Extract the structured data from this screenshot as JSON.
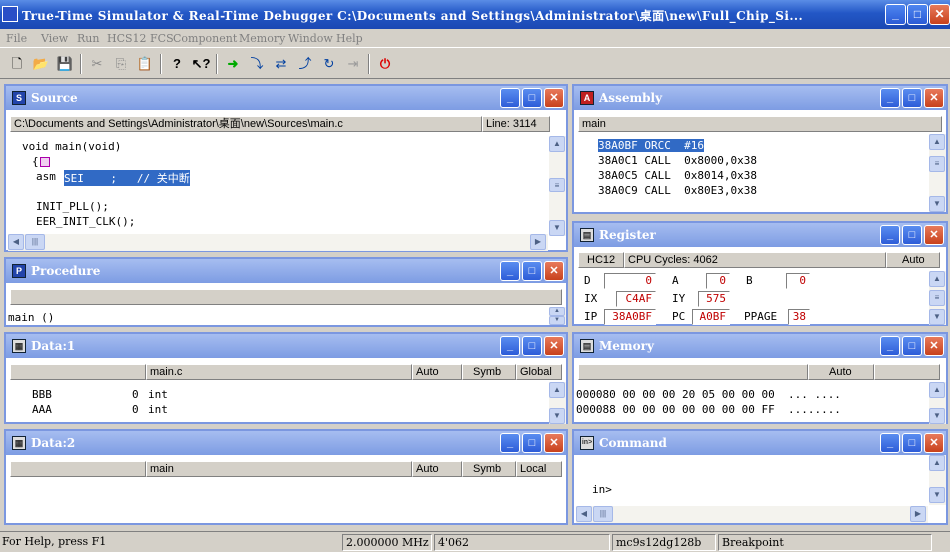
{
  "title": "True-Time Simulator & Real-Time Debugger   C:\\Documents and Settings\\Administrator\\桌面\\new\\Full_Chip_Si...",
  "menu": [
    "File",
    "View",
    "Run",
    "HCS12 FCS",
    "Component",
    "Memory",
    "Window",
    "Help"
  ],
  "source": {
    "title": "Source",
    "path": "C:\\Documents and Settings\\Administrator\\桌面\\new\\Sources\\main.c",
    "line_label": "Line: 3114",
    "code": [
      "void main(void)",
      "{",
      "asm",
      "SEI    ;   // 关中断",
      "INIT_PLL();",
      "EER_INIT_CLK();"
    ]
  },
  "procedure": {
    "title": "Procedure",
    "entry": "main ()"
  },
  "data1": {
    "title": "Data:1",
    "file": "main.c",
    "mode": "Auto",
    "format": "Symb",
    "scope": "Global",
    "rows": [
      {
        "name": "BBB",
        "value": "0",
        "type": "int"
      },
      {
        "name": "AAA",
        "value": "0",
        "type": "int"
      }
    ]
  },
  "data2": {
    "title": "Data:2",
    "file": "main",
    "mode": "Auto",
    "format": "Symb",
    "scope": "Local"
  },
  "assembly": {
    "title": "Assembly",
    "func": "main",
    "rows": [
      {
        "addr": "38A0BF",
        "op": "ORCC",
        "arg": "#16"
      },
      {
        "addr": "38A0C1",
        "op": "CALL",
        "arg": "0x8000,0x38"
      },
      {
        "addr": "38A0C5",
        "op": "CALL",
        "arg": "0x8014,0x38"
      },
      {
        "addr": "38A0C9",
        "op": "CALL",
        "arg": "0x80E3,0x38"
      }
    ]
  },
  "register": {
    "title": "Register",
    "cpu": "HC12",
    "cycles": "CPU Cycles: 4062",
    "mode": "Auto",
    "D": "0",
    "A": "0",
    "B": "0",
    "IX": "C4AF",
    "IY": "575",
    "IP": "38A0BF",
    "PC": "A0BF",
    "PPAGE": "38",
    "labels": {
      "d": "D",
      "a": "A",
      "b": "B",
      "ix": "IX",
      "iy": "IY",
      "ip": "IP",
      "pc": "PC",
      "ppage": "PPAGE"
    }
  },
  "memory": {
    "title": "Memory",
    "mode": "Auto",
    "rows": [
      {
        "addr": "000080",
        "bytes": "00 00 00 20 05 00 00 00",
        "ascii": "... ...."
      },
      {
        "addr": "000088",
        "bytes": "00 00 00 00 00 00 00 FF",
        "ascii": "........"
      }
    ]
  },
  "command": {
    "title": "Command",
    "prompt": "in>"
  },
  "status": {
    "help": "For Help, press F1",
    "freq": "2.000000 MHz",
    "cycles": "4'062",
    "chip": "mc9s12dg128b",
    "state": "Breakpoint"
  },
  "colors": {
    "title_bar": "#2357c6",
    "window_header": "#7d9ce3",
    "highlight": "#316ac5",
    "register_value": "#c00000"
  }
}
